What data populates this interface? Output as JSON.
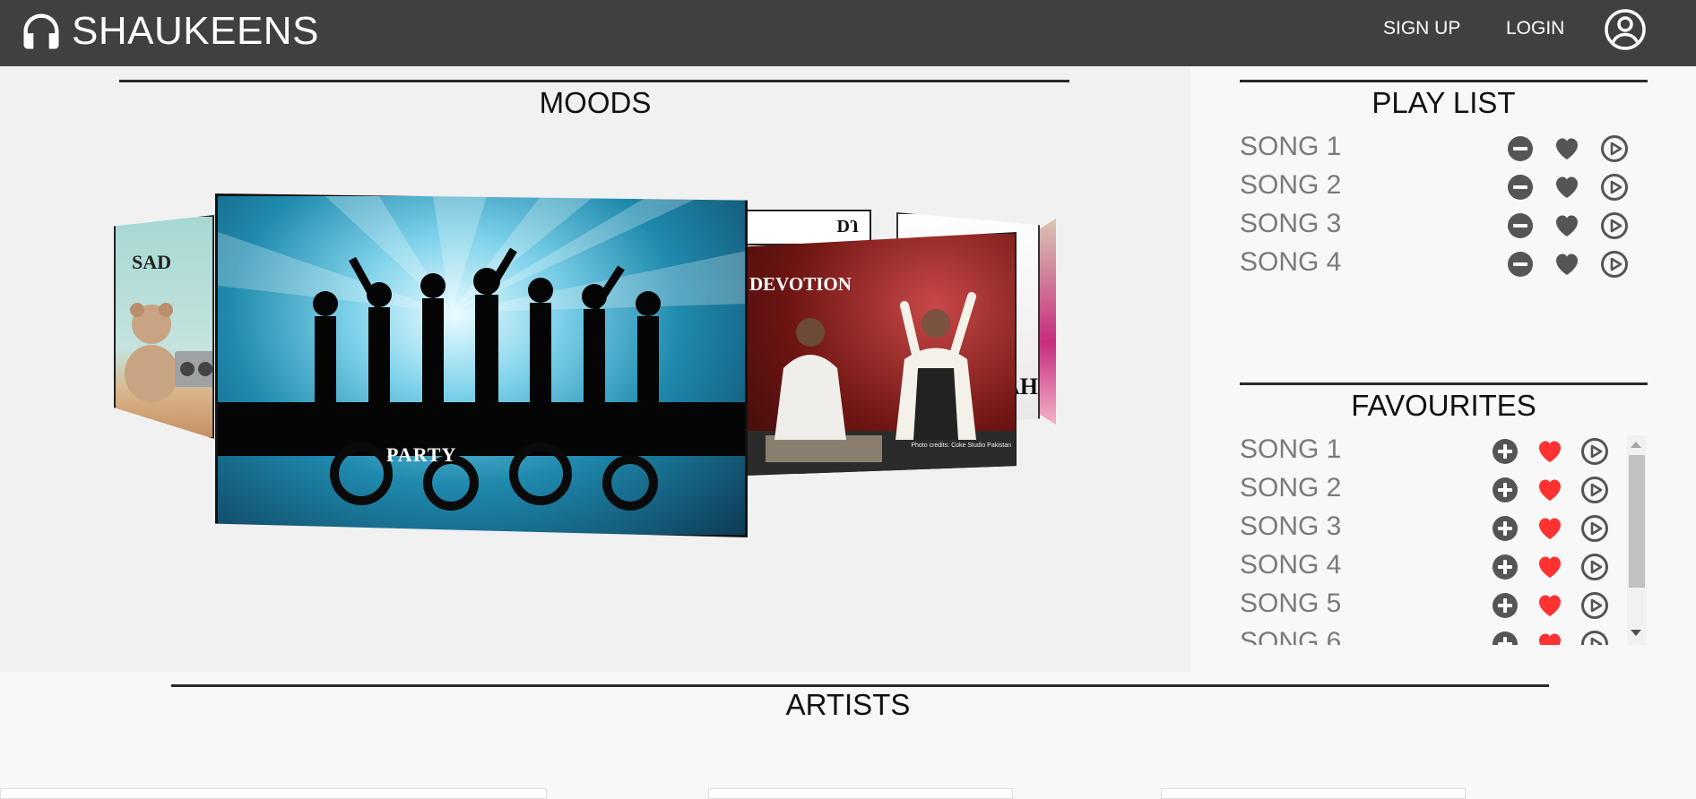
{
  "header": {
    "brand": "SHAUKEENS",
    "brand_icon": "headphones-icon",
    "nav": {
      "signup": "SIGN UP",
      "login": "LOGIN"
    },
    "account_icon": "account-circle-icon"
  },
  "moods": {
    "title": "MOODS",
    "cards": [
      {
        "label": "SAD"
      },
      {
        "label": "PARTY"
      },
      {
        "label": "DJ"
      },
      {
        "label": "DEVOTION"
      },
      {
        "label": "AH"
      }
    ],
    "photo_credit": "Photo credits: Coke Studio Pakistan"
  },
  "playlist": {
    "title": "PLAY LIST",
    "songs": [
      "SONG 1",
      "SONG 2",
      "SONG 3",
      "SONG 4"
    ]
  },
  "favourites": {
    "title": "FAVOURITES",
    "songs": [
      "SONG 1",
      "SONG 2",
      "SONG 3",
      "SONG 4",
      "SONG 5",
      "SONG 6"
    ]
  },
  "artists": {
    "title": "ARTISTS"
  },
  "colors": {
    "header_bg": "#404041",
    "heart_active": "#ff3131",
    "icon_gray": "#555555"
  }
}
